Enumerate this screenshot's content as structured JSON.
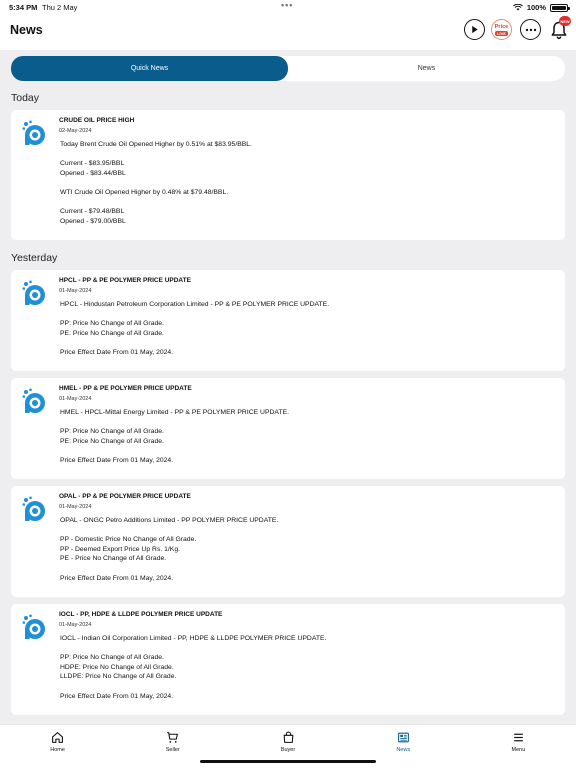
{
  "status_bar": {
    "time": "5:34 PM",
    "date": "Thu 2 May",
    "battery": "100%"
  },
  "header": {
    "title": "News",
    "price_label": "Price",
    "price_live": "LIVE",
    "bell_badge": "NEW"
  },
  "tabs": [
    {
      "label": "Quick News",
      "active": true
    },
    {
      "label": "News",
      "active": false
    }
  ],
  "sections": {
    "today": "Today",
    "yesterday": "Yesterday"
  },
  "cards": [
    {
      "title": "CRUDE OIL PRICE HIGH",
      "date": "02-May-2024",
      "lines": [
        "Today Brent Crude Oil Opened Higher by 0.51% at $83.95/BBL.",
        "",
        "Current - $83.95/BBL",
        "Opened - $83.44/BBL",
        "",
        "WTI Crude Oil Opened Higher by 0.48% at $79.48/BBL.",
        "",
        "Current - $79.48/BBL",
        "Opened - $79.00/BBL"
      ]
    },
    {
      "title": "HPCL - PP & PE POLYMER PRICE UPDATE",
      "date": "01-May-2024",
      "lines": [
        "HPCL - Hindustan Petroleum Corporation Limited - PP & PE POLYMER PRICE UPDATE.",
        "",
        "PP: Price No Change of All Grade.",
        "PE: Price No Change of All Grade.",
        "",
        "Price Effect Date From 01 May, 2024."
      ]
    },
    {
      "title": "HMEL - PP & PE POLYMER PRICE UPDATE",
      "date": "01-May-2024",
      "lines": [
        "HMEL - HPCL-Mittal Energy Limited - PP & PE POLYMER PRICE UPDATE.",
        "",
        "PP: Price No Change of All Grade.",
        "PE: Price No Change of All Grade.",
        "",
        "Price Effect Date From 01 May, 2024."
      ]
    },
    {
      "title": "OPAL - PP & PE POLYMER PRICE UPDATE",
      "date": "01-May-2024",
      "lines": [
        "OPAL - ONGC Petro Additions Limited - PP POLYMER PRICE UPDATE.",
        "",
        "PP - Domestic Price No Change of All Grade.",
        "PP - Deemed Export Price Up Rs. 1/Kg.",
        "PE - Price No Change of All Grade.",
        "",
        "Price Effect Date From 01 May, 2024."
      ]
    },
    {
      "title": "IOCL - PP, HDPE & LLDPE POLYMER PRICE UPDATE",
      "date": "01-May-2024",
      "lines": [
        "IOCL - Indian Oil Corporation Limited - PP, HDPE & LLDPE POLYMER PRICE UPDATE.",
        "",
        "PP: Price No Change of All Grade.",
        "HDPE: Price No Change of All Grade.",
        "LLDPE: Price No Change of All Grade.",
        "",
        "Price Effect Date From 01 May, 2024."
      ]
    }
  ],
  "bottom_nav": [
    {
      "label": "Home",
      "icon": "home-icon"
    },
    {
      "label": "Seller",
      "icon": "cart-icon"
    },
    {
      "label": "Buyer",
      "icon": "bag-icon"
    },
    {
      "label": "News",
      "icon": "newspaper-icon",
      "active": true
    },
    {
      "label": "Menu",
      "icon": "menu-icon"
    }
  ],
  "colors": {
    "accent": "#0a5c8d",
    "background": "#eeeef1",
    "badge": "#e02d2d"
  }
}
